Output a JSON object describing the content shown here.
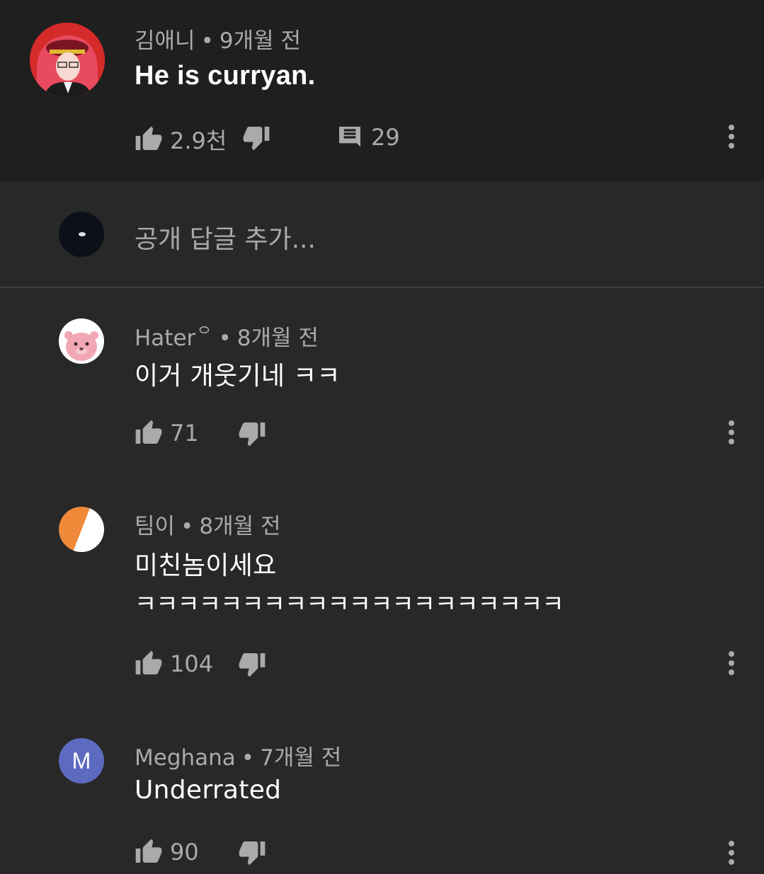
{
  "parent_comment": {
    "author": "김애니",
    "time": "9개월 전",
    "text": "He is curryan.",
    "likes": "2.9천",
    "replies_count": "29"
  },
  "reply_box": {
    "placeholder": "공개 답글 추가..."
  },
  "replies": [
    {
      "author": "Hater꒪",
      "time": "8개월 전",
      "text": "이거 개웃기네 ㅋㅋ",
      "likes": "71"
    },
    {
      "author": "팀이",
      "time": "8개월 전",
      "text": "미친놈이세요",
      "text_line2": "ㅋㅋㅋㅋㅋㅋㅋㅋㅋㅋㅋㅋㅋㅋㅋㅋㅋㅋㅋㅋ",
      "likes": "104"
    },
    {
      "author": "Meghana",
      "avatar_letter": "M",
      "time": "7개월 전",
      "text": "Underrated",
      "likes": "90"
    }
  ],
  "separator": "•",
  "icons": {
    "like": "thumb-up-icon",
    "dislike": "thumb-down-icon",
    "reply": "comment-icon",
    "more": "more-vert-icon"
  },
  "colors": {
    "background": "#282828",
    "parent_background": "#1f1f1f",
    "secondary_text": "#aaaaaa",
    "orange_avatar": "#f08a3a",
    "meghana_avatar": "#5c6bc0"
  }
}
